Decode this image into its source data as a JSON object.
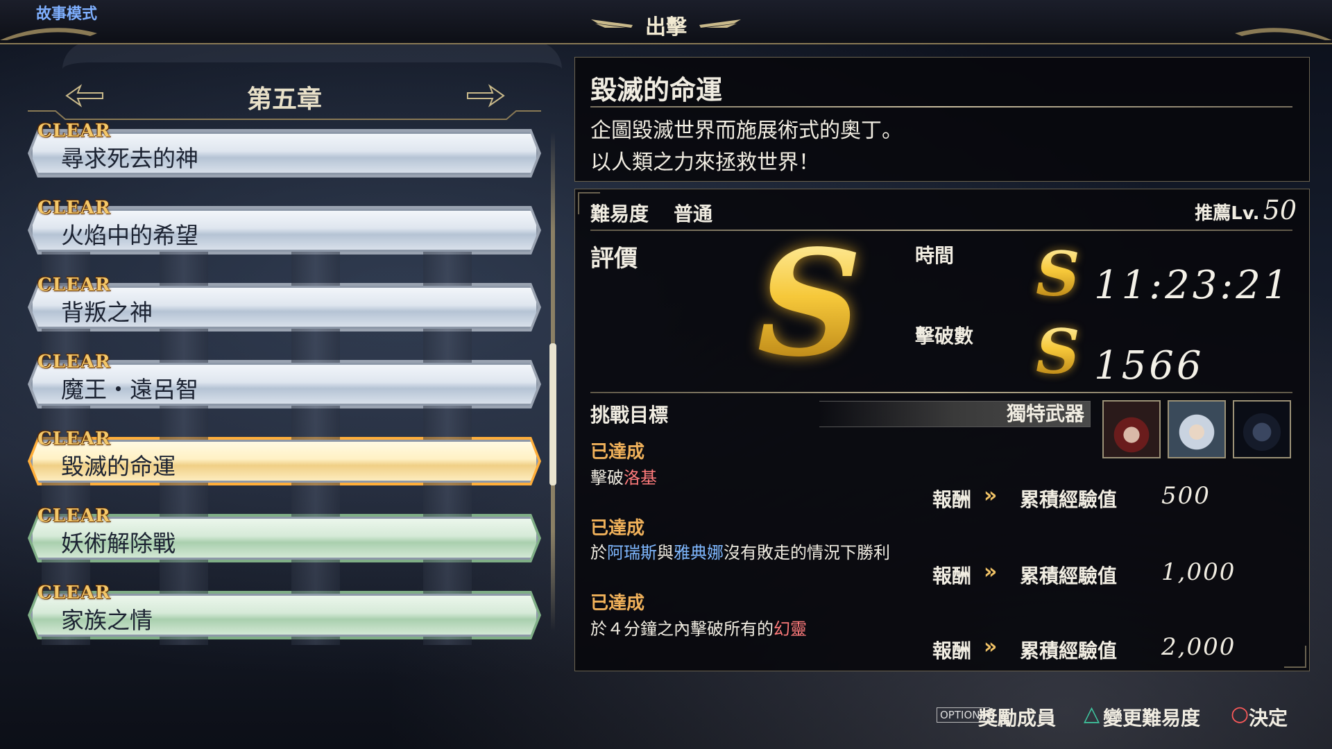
{
  "header": {
    "mode_label": "故事模式",
    "title": "出擊"
  },
  "chapter": {
    "label": "第五章"
  },
  "missions": [
    {
      "status": "CLEAR",
      "name": "尋求死去的神"
    },
    {
      "status": "CLEAR",
      "name": "火焰中的希望"
    },
    {
      "status": "CLEAR",
      "name": "背叛之神"
    },
    {
      "status": "CLEAR",
      "name": "魔王・遠呂智"
    },
    {
      "status": "CLEAR",
      "name": "毀滅的命運"
    },
    {
      "status": "CLEAR",
      "name": "妖術解除戰"
    },
    {
      "status": "CLEAR",
      "name": "家族之情"
    }
  ],
  "detail": {
    "title": "毀滅的命運",
    "desc_line1": "企圖毀滅世界而施展術式的奧丁。",
    "desc_line2": "以人類之力來拯救世界！",
    "difficulty_label": "難易度",
    "difficulty_value": "普通",
    "recommend_label": "推薦Lv.",
    "recommend_value": "50",
    "rating_label": "評價",
    "overall_rank": "S",
    "time_label": "時間",
    "time_rank": "S",
    "time_value": "11:23:21",
    "kills_label": "擊破數",
    "kills_rank": "S",
    "kills_value": "1566",
    "challenge_label": "挑戰目標",
    "unique_weapon_label": "獨特武器",
    "portraits": [
      "portrait-hooded-warrior",
      "portrait-white-haired-warrior",
      "portrait-dark-demon"
    ],
    "goals": [
      {
        "status": "已達成",
        "cond_parts": [
          "擊破",
          "洛基",
          ""
        ],
        "reward_label": "報酬",
        "reward_kind": "累積經驗值",
        "reward_value": "500"
      },
      {
        "status": "已達成",
        "cond_parts": [
          "於",
          "阿瑞斯",
          "與",
          "雅典娜",
          "沒有敗走的情況下勝利"
        ],
        "reward_label": "報酬",
        "reward_kind": "累積經驗值",
        "reward_value": "1,000"
      },
      {
        "status": "已達成",
        "cond_parts": [
          "於４分鐘之內擊破所有的",
          "幻靈",
          ""
        ],
        "reward_label": "報酬",
        "reward_kind": "累積經驗值",
        "reward_value": "2,000"
      }
    ]
  },
  "hints": {
    "options_key": "OPTIONS",
    "options_label": "獎勵成員",
    "triangle_label": "變更難易度",
    "circle_label": "決定"
  },
  "colors": {
    "accent_gold": "#f0b15a",
    "highlight_red": "#ff7b7b",
    "highlight_blue": "#7fb8ff",
    "active_border": "#ffae3a"
  }
}
